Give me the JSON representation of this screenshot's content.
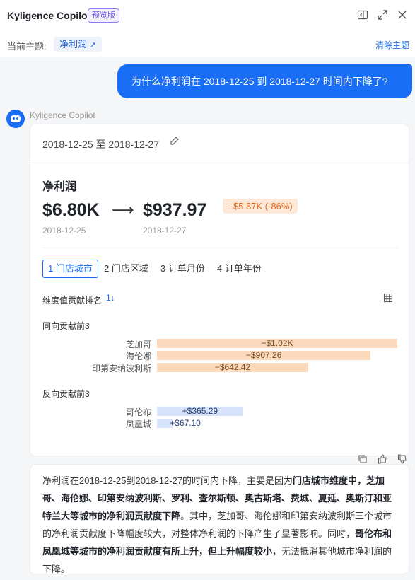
{
  "header": {
    "title": "Kyligence Copilot",
    "badge": "预览版",
    "icons": [
      "sidebar-toggle-icon",
      "expand-icon",
      "close-icon"
    ]
  },
  "topic": {
    "label": "当前主题:",
    "chip": "净利润",
    "clear": "清除主题"
  },
  "user_message": "为什么净利润在 2018-12-25 到 2018-12-27 时间内下降了?",
  "bot": {
    "name": "Kyligence Copilot",
    "card": {
      "range": "2018-12-25 至 2018-12-27",
      "metric": "净利润",
      "from_value": "$6.80K",
      "to_value": "$937.97",
      "delta": "- $5.87K (-86%)",
      "from_date": "2018-12-25",
      "to_date": "2018-12-27",
      "tabs": [
        "1 门店城市",
        "2 门店区域",
        "3 订单月份",
        "4 订单年份"
      ],
      "ranking_title": "维度值贡献排名",
      "positive_title": "同向贡献前3",
      "negative_title": "反向贡献前3"
    }
  },
  "chart_data": [
    {
      "type": "bar",
      "title": "同向贡献前3",
      "categories": [
        "芝加哥",
        "海伦娜",
        "印第安纳波利斯"
      ],
      "values": [
        -1020,
        -907.26,
        -642.42
      ],
      "labels": [
        "−$1.02K",
        "−$907.26",
        "−$642.42"
      ],
      "color": "#fbd9bd"
    },
    {
      "type": "bar",
      "title": "反向贡献前3",
      "categories": [
        "哥伦布",
        "凤凰城"
      ],
      "values": [
        365.29,
        67.1
      ],
      "labels": [
        "+$365.29",
        "+$67.10"
      ],
      "color": "#d6e3fb"
    }
  ],
  "answer": {
    "p1": "净利润在2018-12-25到2018-12-27的时间内下降，主要是因为",
    "b1": "门店城市维度中，芝加哥、海伦娜、印第安纳波利斯、罗利、查尔斯顿、奥古斯塔、费城、夏延、奥斯汀和亚特兰大等城市的净利润贡献度下降",
    "p2": "。其中，芝加哥、海伦娜和印第安纳波利斯三个城市的净利润贡献度下降幅度较大，对整体净利润的下降产生了显著影响。同时，",
    "b2": "哥伦布和凤凰城等城市的净利润贡献度有所上升，但上升幅度较小",
    "p3": "，无法抵消其他城市净利润的下降。"
  },
  "colors": {
    "accent": "#1a6ef5",
    "negative_bar": "#fbd9bd",
    "positive_bar": "#d6e3fb",
    "delta_bg": "#fde9d9"
  }
}
